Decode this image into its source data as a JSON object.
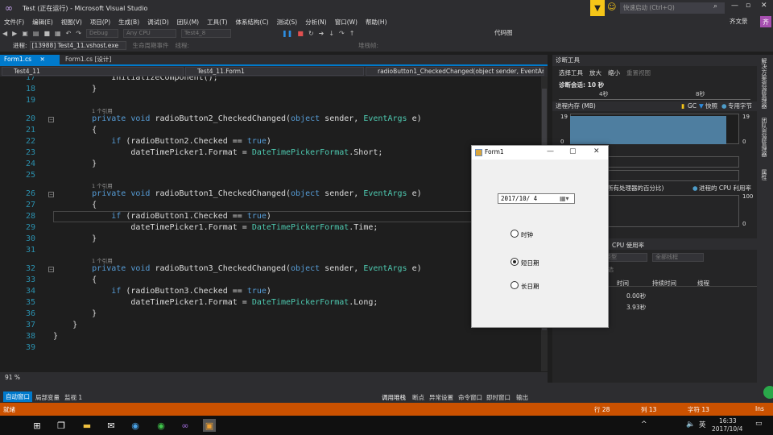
{
  "window": {
    "title": "Test (正在运行) - Microsoft Visual Studio",
    "quick_launch_placeholder": "快速启动 (Ctrl+Q)",
    "user_name": "齐文景",
    "user_initial": "齐"
  },
  "menu": [
    "文件(F)",
    "编辑(E)",
    "视图(V)",
    "项目(P)",
    "生成(B)",
    "调试(D)",
    "团队(M)",
    "工具(T)",
    "体系结构(C)",
    "测试(S)",
    "分析(N)",
    "窗口(W)",
    "帮助(H)"
  ],
  "toolbar": {
    "config": "Debug",
    "platform": "Any CPU",
    "startup": "Test4_8",
    "code_map": "代码图"
  },
  "process_bar": {
    "process_label": "进程:",
    "process_value": "[13988] Test4_11.vshost.exe",
    "lifecycle_label": "生命周期事件",
    "thread_label": "线程:",
    "stack_label": "堆栈帧:"
  },
  "doc_tabs": [
    {
      "label": "Form1.cs",
      "active": true
    },
    {
      "label": "Form1.cs [设计]",
      "active": false
    }
  ],
  "nav": {
    "project": "Test4_11",
    "class": "Test4_11.Form1",
    "member": "radioButton1_CheckedChanged(object sender, EventArgs e)"
  },
  "code_lines": [
    {
      "n": "17",
      "parts": [
        [
          "tx",
          "            InitializeComponent();"
        ]
      ]
    },
    {
      "n": "18",
      "parts": [
        [
          "tx",
          "        }"
        ]
      ]
    },
    {
      "n": "19",
      "parts": [
        [
          "tx",
          ""
        ]
      ]
    },
    {
      "n": "20",
      "lens": "1 个引用",
      "parts": [
        [
          "kw",
          "        private void "
        ],
        [
          "tx",
          "radioButton2_CheckedChanged("
        ],
        [
          "kw",
          "object "
        ],
        [
          "tx",
          "sender, "
        ],
        [
          "ty",
          "EventArgs "
        ],
        [
          "tx",
          "e)"
        ]
      ]
    },
    {
      "n": "21",
      "parts": [
        [
          "tx",
          "        {"
        ]
      ]
    },
    {
      "n": "22",
      "parts": [
        [
          "kw",
          "            if "
        ],
        [
          "tx",
          "(radioButton2.Checked == "
        ],
        [
          "kw",
          "true"
        ],
        [
          "tx",
          ")"
        ]
      ]
    },
    {
      "n": "23",
      "parts": [
        [
          "tx",
          "                dateTimePicker1.Format = "
        ],
        [
          "ty",
          "DateTimePickerFormat"
        ],
        [
          "tx",
          ".Short;"
        ]
      ]
    },
    {
      "n": "24",
      "parts": [
        [
          "tx",
          "        }"
        ]
      ]
    },
    {
      "n": "25",
      "parts": [
        [
          "tx",
          ""
        ]
      ]
    },
    {
      "n": "26",
      "lens": "1 个引用",
      "parts": [
        [
          "kw",
          "        private void "
        ],
        [
          "tx",
          "radioButton1_CheckedChanged("
        ],
        [
          "kw",
          "object "
        ],
        [
          "tx",
          "sender, "
        ],
        [
          "ty",
          "EventArgs "
        ],
        [
          "tx",
          "e)"
        ]
      ]
    },
    {
      "n": "27",
      "parts": [
        [
          "tx",
          "        {"
        ]
      ]
    },
    {
      "n": "28",
      "parts": [
        [
          "kw",
          "            if "
        ],
        [
          "tx",
          "(radioButton1.Checked == "
        ],
        [
          "kw",
          "true"
        ],
        [
          "tx",
          ")"
        ]
      ]
    },
    {
      "n": "29",
      "parts": [
        [
          "tx",
          "                dateTimePicker1.Format = "
        ],
        [
          "ty",
          "DateTimePickerFormat"
        ],
        [
          "tx",
          ".Time;"
        ]
      ]
    },
    {
      "n": "30",
      "parts": [
        [
          "tx",
          "        }"
        ]
      ]
    },
    {
      "n": "31",
      "parts": [
        [
          "tx",
          ""
        ]
      ]
    },
    {
      "n": "32",
      "lens": "1 个引用",
      "parts": [
        [
          "kw",
          "        private void "
        ],
        [
          "tx",
          "radioButton3_CheckedChanged("
        ],
        [
          "kw",
          "object "
        ],
        [
          "tx",
          "sender, "
        ],
        [
          "ty",
          "EventArgs "
        ],
        [
          "tx",
          "e)"
        ]
      ]
    },
    {
      "n": "33",
      "parts": [
        [
          "tx",
          "        {"
        ]
      ]
    },
    {
      "n": "34",
      "parts": [
        [
          "kw",
          "            if "
        ],
        [
          "tx",
          "(radioButton3.Checked == "
        ],
        [
          "kw",
          "true"
        ],
        [
          "tx",
          ")"
        ]
      ]
    },
    {
      "n": "35",
      "parts": [
        [
          "tx",
          "                dateTimePicker1.Format = "
        ],
        [
          "ty",
          "DateTimePickerFormat"
        ],
        [
          "tx",
          ".Long;"
        ]
      ]
    },
    {
      "n": "36",
      "parts": [
        [
          "tx",
          "        }"
        ]
      ]
    },
    {
      "n": "37",
      "parts": [
        [
          "tx",
          "    }"
        ]
      ]
    },
    {
      "n": "38",
      "parts": [
        [
          "tx",
          "}"
        ]
      ]
    },
    {
      "n": "39",
      "parts": [
        [
          "tx",
          ""
        ]
      ]
    }
  ],
  "editor": {
    "zoom": "91 %"
  },
  "diagnostics": {
    "title": "诊断工具",
    "select_tools": "选择工具",
    "zoom_in": "放大",
    "zoom_out": "缩小",
    "reset_view": "重置视图",
    "session": "诊断会话: 10 秒",
    "tick_4s": "4秒",
    "tick_8s": "8秒",
    "mem_header": "进程内存 (MB)",
    "legend_gc": "GC",
    "legend_snapshot": "快照",
    "legend_private": "专用字节",
    "mem_max": "19",
    "mem_min": "0",
    "cpu_header": "所有处理器的百分比)",
    "cpu_legend": "进程的 CPU 利用率",
    "cpu_max": "100",
    "cpu_min": "0",
    "cpu_tab": "CPU 使用率",
    "cpu_filter1": "类型",
    "cpu_filter2": "全部线程",
    "filter_label": "筛选",
    "col_time": "时间",
    "col_duration": "持续时间",
    "col_thread": "线程",
    "row1_time": "0.00秒",
    "row2_time": "3.93秒"
  },
  "side_tabs": [
    "解决方案资源管理器",
    "团队资源管理器",
    "属性"
  ],
  "bottom_tabs": [
    "自动窗口",
    "局部变量",
    "监视 1",
    "调用堆栈",
    "断点",
    "异常设置",
    "命令窗口",
    "即时窗口",
    "输出"
  ],
  "status": {
    "ready": "就绪",
    "line": "行 28",
    "col": "列 13",
    "char": "字符 13",
    "ins": "Ins"
  },
  "taskbar": {
    "time": "16:33",
    "date": "2017/10/4",
    "lang": "英"
  },
  "form1": {
    "title": "Form1",
    "date_value": "2017/10/ 4",
    "radios": [
      {
        "label": "时钟",
        "checked": false
      },
      {
        "label": "短日期",
        "checked": true
      },
      {
        "label": "长日期",
        "checked": false
      }
    ]
  }
}
